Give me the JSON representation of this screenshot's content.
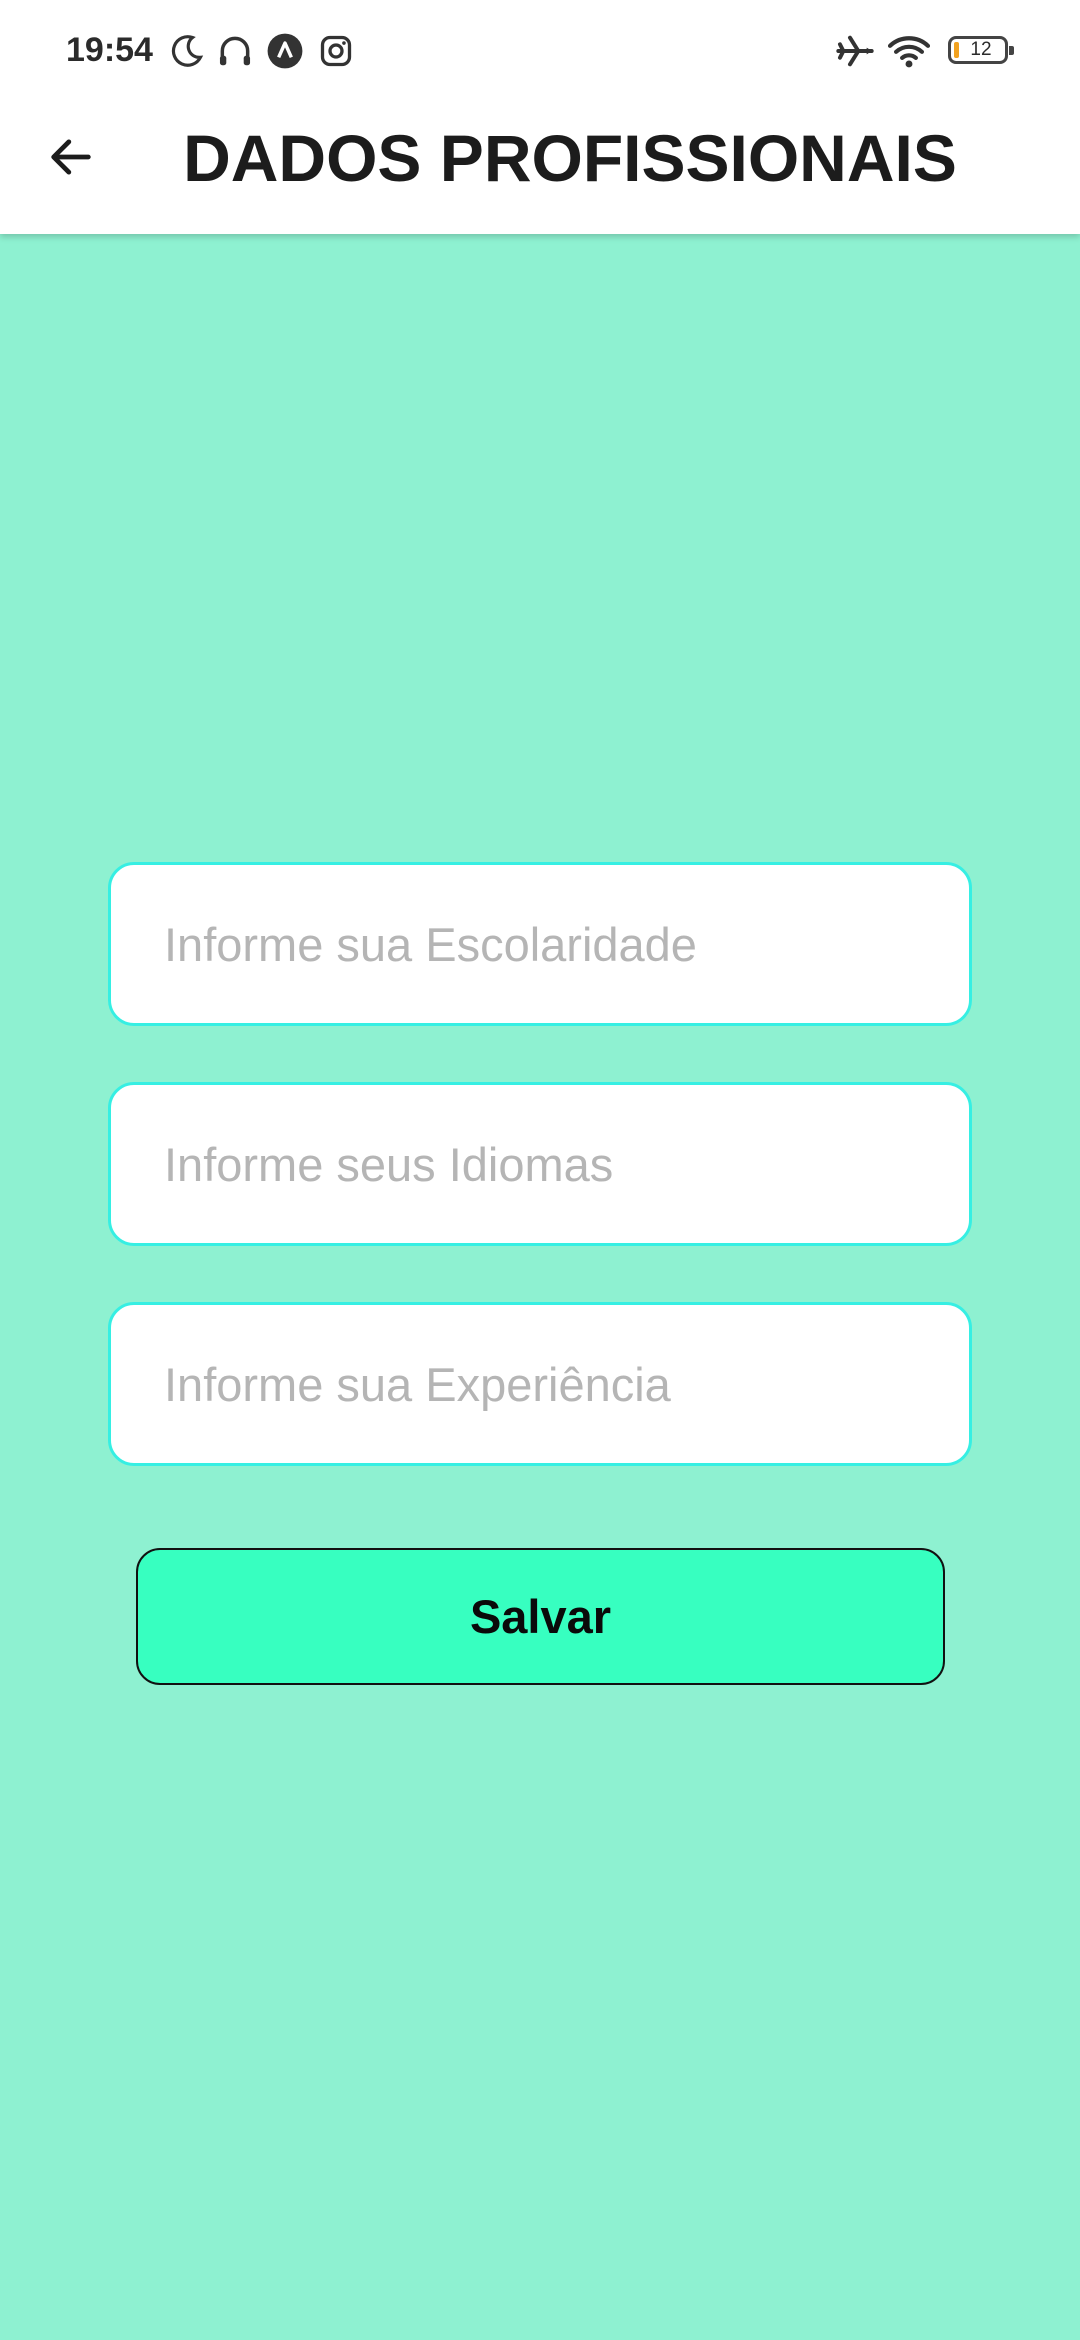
{
  "status_bar": {
    "time": "19:54",
    "battery_level": "12",
    "icons": [
      "moon-icon",
      "headset-icon",
      "app-notification-icon",
      "instagram-icon",
      "airplane-mode-icon",
      "wifi-icon",
      "battery-icon"
    ]
  },
  "appbar": {
    "back_icon": "arrow-left-icon",
    "title": "DADOS PROFISSIONAIS"
  },
  "form": {
    "escolaridade": {
      "value": "",
      "placeholder": "Informe sua Escolaridade"
    },
    "idiomas": {
      "value": "",
      "placeholder": "Informe seus Idiomas"
    },
    "experiencia": {
      "value": "",
      "placeholder": "Informe sua Experiência"
    },
    "save_label": "Salvar"
  },
  "colors": {
    "background": "#8ef1d1",
    "field_border": "#36efe3",
    "button": "#37ffc0",
    "battery_low": "#f2a21f"
  }
}
